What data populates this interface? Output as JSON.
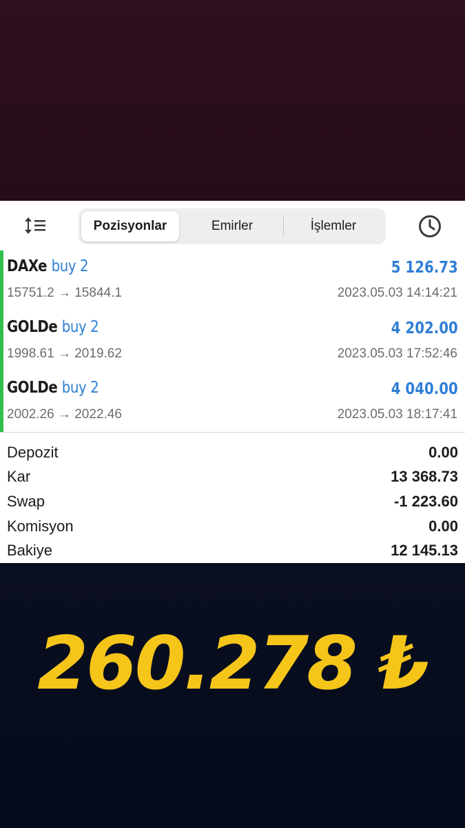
{
  "colors": {
    "top_band": "#2a0d1c",
    "bottom_band": "#050b1c",
    "panel": "#ffffff",
    "accent_blue": "#2f7fd6",
    "position_bar_green": "#2fbf4a",
    "big_amount": "#f6c51a"
  },
  "toolbar": {
    "sort_icon": "sort-icon",
    "history_icon": "clock-icon",
    "tabs": [
      {
        "label": "Pozisyonlar",
        "active": true
      },
      {
        "label": "Emirler",
        "active": false
      },
      {
        "label": "İşlemler",
        "active": false
      }
    ]
  },
  "positions": [
    {
      "symbol": "DAXe",
      "side": "buy 2",
      "profit": "5 126.73",
      "prices": "15751.2 → 15844.1",
      "time": "2023.05.03 14:14:21"
    },
    {
      "symbol": "GOLDe",
      "side": "buy 2",
      "profit": "4 202.00",
      "prices": "1998.61 → 2019.62",
      "time": "2023.05.03 17:52:46"
    },
    {
      "symbol": "GOLDe",
      "side": "buy 2",
      "profit": "4 040.00",
      "prices": "2002.26 → 2022.46",
      "time": "2023.05.03 18:17:41"
    }
  ],
  "summary": [
    {
      "label": "Depozit",
      "value": "0.00"
    },
    {
      "label": "Kar",
      "value": "13 368.73"
    },
    {
      "label": "Swap",
      "value": "-1 223.60"
    },
    {
      "label": "Komisyon",
      "value": "0.00"
    },
    {
      "label": "Bakiye",
      "value": "12 145.13"
    }
  ],
  "big_amount": "260.278 ₺"
}
